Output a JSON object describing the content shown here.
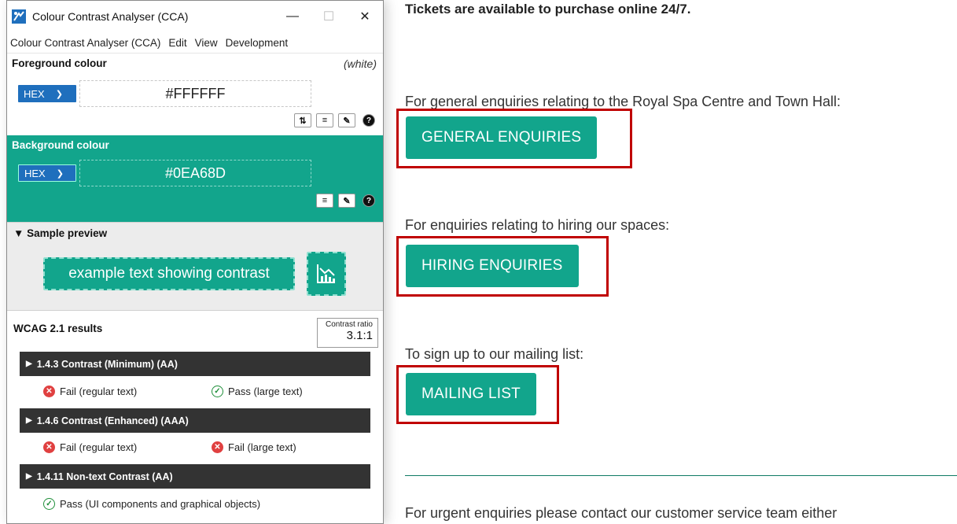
{
  "cca": {
    "title": "Colour Contrast Analyser (CCA)",
    "menu": [
      "Colour Contrast Analyser (CCA)",
      "Edit",
      "View",
      "Development"
    ],
    "foreground": {
      "label": "Foreground colour",
      "name": "(white)",
      "format": "HEX",
      "hex": "#FFFFFF"
    },
    "background": {
      "label": "Background colour",
      "format": "HEX",
      "hex": "#0EA68D"
    },
    "preview": {
      "label": "▼ Sample preview",
      "sample_text": "example text showing contrast"
    },
    "results": {
      "label": "WCAG 2.1 results",
      "ratio_label": "Contrast ratio",
      "ratio": "3.1:1",
      "criteria": [
        {
          "name": "1.4.3 Contrast (Minimum) (AA)",
          "regular": "Fail (regular text)",
          "large": "Pass (large text)"
        },
        {
          "name": "1.4.6 Contrast (Enhanced) (AAA)",
          "regular": "Fail (regular text)",
          "large": "Fail (large text)"
        },
        {
          "name": "1.4.11 Non-text Contrast (AA)",
          "ui": "Pass (UI components and graphical objects)"
        }
      ]
    },
    "colors": {
      "teal": "#12a58c",
      "hex_select": "#1f6fbd",
      "criterion_bar": "#333333",
      "fail": "#e04040",
      "pass": "#1f8f3a"
    }
  },
  "webpage": {
    "tickets": "Tickets are available to purchase online 24/7.",
    "general_text": "For general enquiries relating to the Royal Spa Centre and Town Hall:",
    "general_btn": "GENERAL ENQUIRIES",
    "hiring_text": "For enquiries relating to hiring our spaces:",
    "hiring_btn": "HIRING ENQUIRIES",
    "mailing_text": "To sign up to our mailing list:",
    "mailing_btn": "MAILING LIST",
    "urgent_text": "For urgent enquiries please contact our customer service team either",
    "colors": {
      "button": "#12a58c",
      "highlight": "#c00000"
    }
  }
}
